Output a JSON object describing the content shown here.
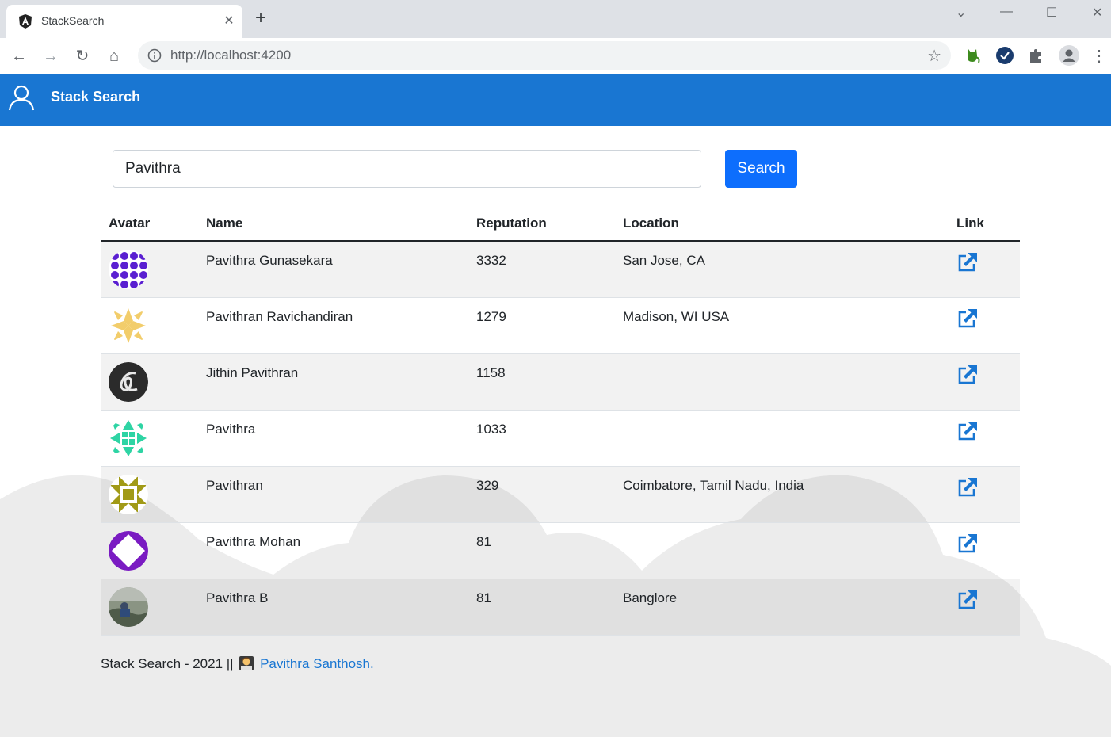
{
  "browser": {
    "tab_title": "StackSearch",
    "tab_close": "✕",
    "new_tab": "+",
    "url": "http://localhost:4200",
    "window_controls": {
      "collapse": "⌄",
      "minimize": "—",
      "maximize": "☐",
      "close": "✕"
    },
    "nav": {
      "back": "←",
      "forward": "→",
      "reload": "↻",
      "home": "⌂"
    },
    "bookmark": "☆",
    "menu": "⋮"
  },
  "app": {
    "title": "Stack Search"
  },
  "search": {
    "value": "Pavithra",
    "button_label": "Search"
  },
  "table": {
    "headers": [
      "Avatar",
      "Name",
      "Reputation",
      "Location",
      "Link"
    ],
    "rows": [
      {
        "name": "Pavithra Gunasekara",
        "reputation": "3332",
        "location": "San Jose, CA",
        "avatar_color": "#5a1fd1"
      },
      {
        "name": "Pavithran Ravichandiran",
        "reputation": "1279",
        "location": "Madison, WI USA",
        "avatar_color": "#f2cd6b"
      },
      {
        "name": "Jithin Pavithran",
        "reputation": "1158",
        "location": "",
        "avatar_color": "#2b2b2b"
      },
      {
        "name": "Pavithra",
        "reputation": "1033",
        "location": "",
        "avatar_color": "#2ed4a4"
      },
      {
        "name": "Pavithran",
        "reputation": "329",
        "location": "Coimbatore, Tamil Nadu, India",
        "avatar_color": "#a19a17"
      },
      {
        "name": "Pavithra Mohan",
        "reputation": "81",
        "location": "",
        "avatar_color": "#7a1bc2"
      },
      {
        "name": "Pavithra B",
        "reputation": "81",
        "location": "Banglore",
        "avatar_color": "#6b7a6a"
      }
    ]
  },
  "footer": {
    "text": "Stack Search - 2021 ||",
    "link_text": "Pavithra Santhosh."
  },
  "colors": {
    "header_bg": "#1976d2",
    "button_bg": "#0d6efd",
    "link_icon": "#1976d2"
  }
}
